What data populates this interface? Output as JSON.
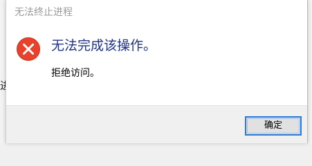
{
  "window": {
    "title": "无法终止进程"
  },
  "backdrop": {
    "partial_text": "进"
  },
  "message": {
    "icon": "error-icon",
    "main_instruction": "无法完成该操作。",
    "detail": "拒绝访问。"
  },
  "buttons": {
    "ok_label": "确定"
  },
  "colors": {
    "instruction_text": "#1e3287",
    "error_icon_fill": "#e8412c",
    "button_focus_border": "#2b78d4"
  }
}
